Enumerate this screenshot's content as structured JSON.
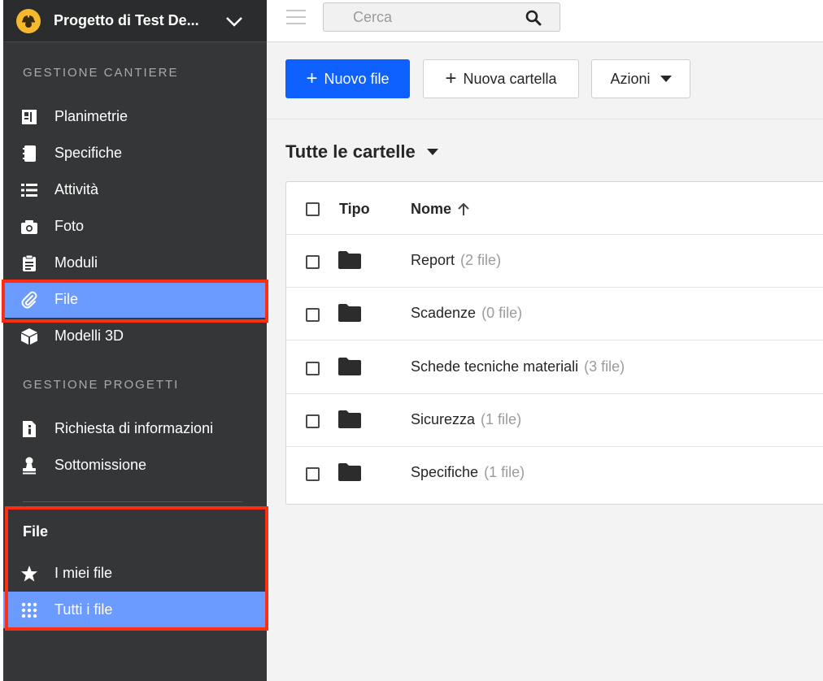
{
  "project": {
    "title": "Progetto di Test De..."
  },
  "sidebar": {
    "sections": [
      {
        "label": "GESTIONE CANTIERE",
        "items": [
          {
            "label": "Planimetrie",
            "icon": "floorplan-icon"
          },
          {
            "label": "Specifiche",
            "icon": "notebook-icon"
          },
          {
            "label": "Attività",
            "icon": "list-icon"
          },
          {
            "label": "Foto",
            "icon": "camera-icon"
          },
          {
            "label": "Moduli",
            "icon": "clipboard-icon"
          },
          {
            "label": "File",
            "icon": "paperclip-icon",
            "active": true
          },
          {
            "label": "Modelli 3D",
            "icon": "cube-icon"
          }
        ]
      },
      {
        "label": "GESTIONE PROGETTI",
        "items": [
          {
            "label": "Richiesta di informazioni",
            "icon": "info-document-icon"
          },
          {
            "label": "Sottomissione",
            "icon": "stamp-icon"
          }
        ]
      }
    ],
    "files_panel": {
      "title": "File",
      "items": [
        {
          "label": "I miei file",
          "icon": "star-icon"
        },
        {
          "label": "Tutti i file",
          "icon": "grid-dots-icon",
          "active": true
        }
      ]
    }
  },
  "topbar": {
    "search_placeholder": "Cerca"
  },
  "actions": {
    "new_file": "Nuovo file",
    "new_folder": "Nuova cartella",
    "actions_menu": "Azioni"
  },
  "folder_scope": "Tutte le cartelle",
  "table": {
    "columns": {
      "type": "Tipo",
      "name": "Nome"
    },
    "rows": [
      {
        "name": "Report",
        "count": "(2 file)"
      },
      {
        "name": "Scadenze",
        "count": "(0 file)"
      },
      {
        "name": "Schede tecniche materiali",
        "count": "(3 file)"
      },
      {
        "name": "Sicurezza",
        "count": "(1 file)"
      },
      {
        "name": "Specifiche",
        "count": "(1 file)"
      }
    ]
  },
  "colors": {
    "sidebar_bg": "#353637",
    "active_item": "#6b9bff",
    "primary_button": "#0e60ff",
    "highlight_border": "#ff2e12"
  }
}
